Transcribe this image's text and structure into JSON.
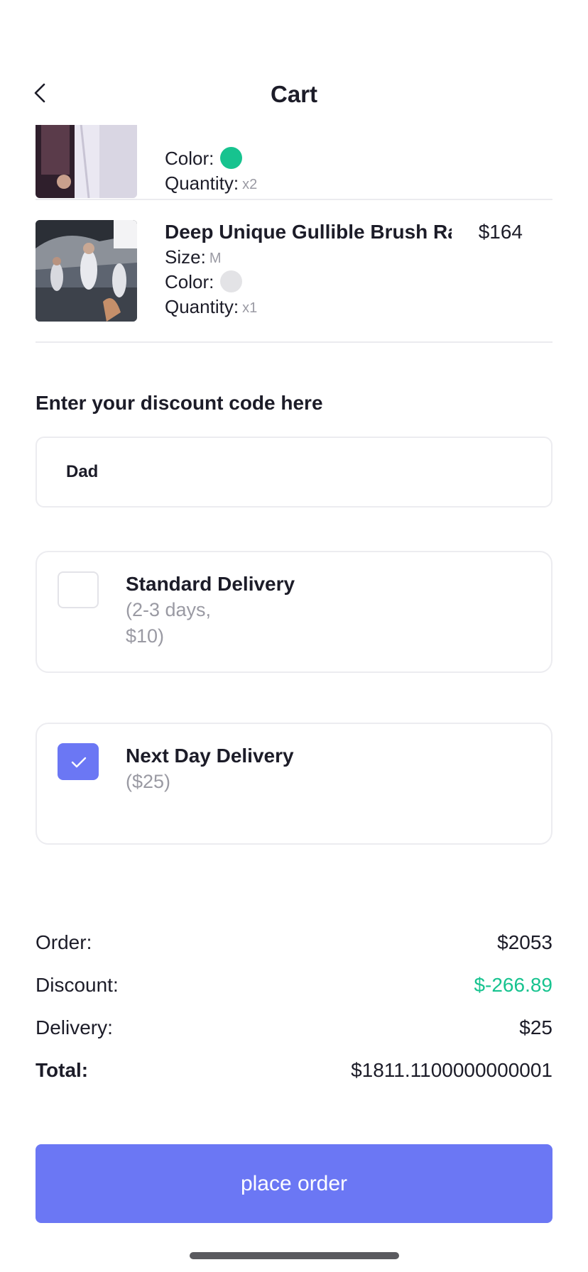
{
  "header": {
    "title": "Cart"
  },
  "cart": {
    "items": [
      {
        "color_label": "Color:",
        "color_hex": "#17c38f",
        "quantity_label": "Quantity:",
        "quantity": "x2"
      },
      {
        "name": "Deep Unique Gullible Brush Raw",
        "price": "$164",
        "size_label": "Size:",
        "size": "M",
        "color_label": "Color:",
        "color_hex": "#e3e3e6",
        "quantity_label": "Quantity:",
        "quantity": "x1"
      }
    ]
  },
  "discount": {
    "heading": "Enter your discount code here",
    "code": "Dad"
  },
  "delivery": {
    "options": [
      {
        "title": "Standard Delivery",
        "detail_line1": "(2-3 days,",
        "detail_line2": "$10)",
        "checked": false
      },
      {
        "title": "Next Day Delivery",
        "detail_line1": "($25)",
        "checked": true
      }
    ]
  },
  "summary": {
    "order_label": "Order:",
    "order_value": "$2053",
    "discount_label": "Discount:",
    "discount_value": "$-266.89",
    "delivery_label": "Delivery:",
    "delivery_value": "$25",
    "total_label": "Total:",
    "total_value": "$1811.1100000000001"
  },
  "actions": {
    "place_order": "place order"
  },
  "colors": {
    "accent": "#6b77f4",
    "discount_green": "#17c38f"
  }
}
